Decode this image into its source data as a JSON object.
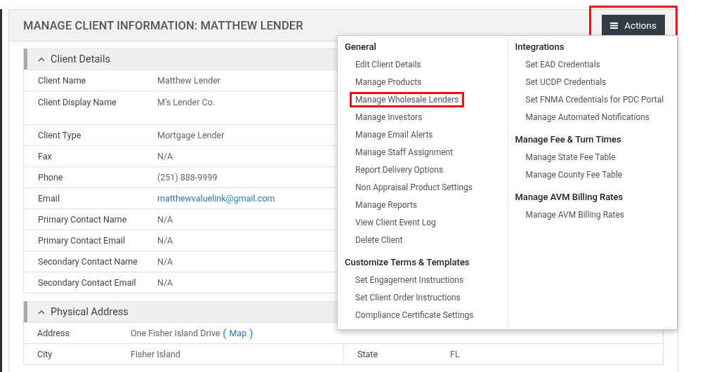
{
  "page": {
    "title": "MANAGE CLIENT INFORMATION: MATTHEW LENDER"
  },
  "actions_button": {
    "label": "Actions",
    "highlighted": true
  },
  "sections": [
    {
      "title": "Client Details",
      "expanded": true,
      "rows": [
        {
          "kind": "text",
          "label": "Client Name",
          "value": "Matthew Lender"
        },
        {
          "kind": "tall",
          "label": "Client Display Name",
          "value": "M’s Lender Co."
        },
        {
          "kind": "text",
          "label": "Client Type",
          "value": "Mortgage Lender"
        },
        {
          "kind": "text",
          "label": "Fax",
          "value": "N/A"
        },
        {
          "kind": "text",
          "label": "Phone",
          "value": "(251) 888-9999"
        },
        {
          "kind": "link",
          "label": "Email",
          "value": "matthewvaluelink@gmail.com"
        },
        {
          "kind": "text",
          "label": "Primary Contact Name",
          "value": "N/A"
        },
        {
          "kind": "text",
          "label": "Primary Contact Email",
          "value": "N/A"
        },
        {
          "kind": "text",
          "label": "Secondary Contact Name",
          "value": "N/A"
        },
        {
          "kind": "text",
          "label": "Secondary Contact Email",
          "value": "N/A"
        }
      ]
    },
    {
      "title": "Physical Address",
      "expanded": true,
      "rows": [
        {
          "kind": "address",
          "label": "Address",
          "value": "One Fisher Island Drive",
          "link_before": "(",
          "link": "Map",
          "link_after": ")"
        },
        {
          "kind": "pair",
          "label": "City",
          "value": "Fisher Island",
          "label_2": "State",
          "value_2": "FL"
        }
      ]
    }
  ],
  "menu": {
    "columns": [
      {
        "groups": [
          {
            "title": "General",
            "items": [
              {
                "label": "Edit Client Details",
                "highlighted": false
              },
              {
                "label": "Manage Products",
                "highlighted": false
              },
              {
                "label": "Manage Wholesale Lenders",
                "highlighted": true
              },
              {
                "label": "Manage Investors",
                "highlighted": false
              },
              {
                "label": "Manage Email Alerts",
                "highlighted": false
              },
              {
                "label": "Manage Staff Assignment",
                "highlighted": false
              },
              {
                "label": "Report Delivery Options",
                "highlighted": false
              },
              {
                "label": "Non Appraisal Product Settings",
                "highlighted": false
              },
              {
                "label": "Manage Reports",
                "highlighted": false
              },
              {
                "label": "View Client Event Log",
                "highlighted": false
              },
              {
                "label": "Delete Client",
                "highlighted": false
              }
            ]
          },
          {
            "title": "Customize Terms & Templates",
            "items": [
              {
                "label": "Set Engagement Instructions",
                "highlighted": false
              },
              {
                "label": "Set Client Order Instructions",
                "highlighted": false
              },
              {
                "label": "Compliance Certificate Settings",
                "highlighted": false
              }
            ]
          }
        ]
      },
      {
        "groups": [
          {
            "title": "Integrations",
            "items": [
              {
                "label": "Set EAD Credentials",
                "highlighted": false
              },
              {
                "label": "Set UCDP Credentials",
                "highlighted": false
              },
              {
                "label": "Set FNMA Credentials for PDC Portal",
                "highlighted": false
              },
              {
                "label": "Manage Automated Notifications",
                "highlighted": false
              }
            ]
          },
          {
            "title": "Manage Fee & Turn Times",
            "items": [
              {
                "label": "Manage State Fee Table",
                "highlighted": false
              },
              {
                "label": "Manage County Fee Table",
                "highlighted": false
              }
            ]
          },
          {
            "title": "Manage AVM Billing Rates",
            "items": [
              {
                "label": "Manage AVM Billing Rates",
                "highlighted": false
              }
            ]
          }
        ]
      }
    ]
  }
}
